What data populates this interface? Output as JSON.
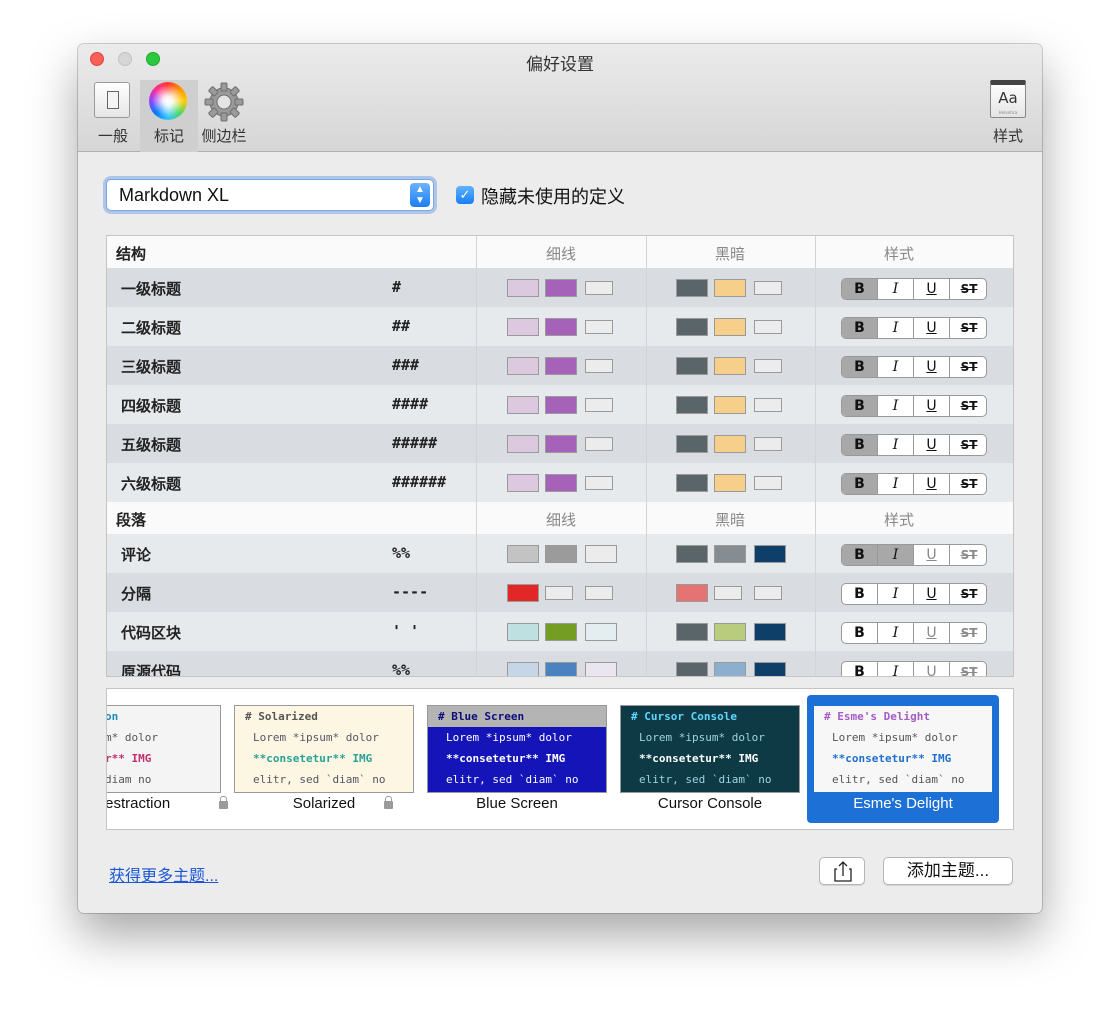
{
  "window": {
    "title": "偏好设置"
  },
  "toolbar": {
    "general_label": "一般",
    "markers_label": "标记",
    "sidebar_label": "侧边栏",
    "style_label": "样式",
    "style_icon_text": "Aa",
    "style_icon_sub": "Helvetica"
  },
  "syntax_select": {
    "value": "Markdown XL"
  },
  "hide_unused": {
    "label": "隐藏未使用的定义",
    "checked": true
  },
  "table": {
    "columns": {
      "thin": "细线",
      "dark": "黑暗",
      "style": "样式"
    },
    "sections": [
      {
        "title": "结构",
        "rows": [
          {
            "name": "一级标题",
            "syntax": "#"
          },
          {
            "name": "二级标题",
            "syntax": "##"
          },
          {
            "name": "三级标题",
            "syntax": "###"
          },
          {
            "name": "四级标题",
            "syntax": "####"
          },
          {
            "name": "五级标题",
            "syntax": "#####"
          },
          {
            "name": "六级标题",
            "syntax": "######"
          }
        ]
      },
      {
        "title": "段落",
        "rows": [
          {
            "name": "评论",
            "syntax": "%%"
          },
          {
            "name": "分隔",
            "syntax": "----"
          },
          {
            "name": "代码区块",
            "syntax": "' '"
          },
          {
            "name": "原源代码",
            "syntax": "%%"
          }
        ]
      }
    ],
    "style_buttons": {
      "bold": "B",
      "italic": "I",
      "underline": "U",
      "strike": "ST"
    }
  },
  "themes": [
    {
      "name": "reestraction",
      "locked": true,
      "lines": [
        "estraction",
        "em *ipsum* dolor",
        "onsetetur** IMG",
        "tr, sed diam no"
      ]
    },
    {
      "name": "Solarized",
      "locked": true,
      "lines": [
        "# Solarized",
        "Lorem *ipsum* dolor",
        "**consetetur** IMG",
        "elitr, sed `diam` no"
      ]
    },
    {
      "name": "Blue Screen",
      "locked": false,
      "lines": [
        "# Blue Screen",
        "Lorem *ipsum* dolor",
        "**consetetur** IMG",
        "elitr, sed `diam` no"
      ]
    },
    {
      "name": "Cursor Console",
      "locked": false,
      "lines": [
        "# Cursor Console",
        "Lorem *ipsum* dolor",
        "**consetetur** IMG",
        "elitr, sed `diam` no"
      ]
    },
    {
      "name": "Esme's Delight",
      "locked": false,
      "selected": true,
      "lines": [
        "# Esme's Delight",
        "Lorem *ipsum* dolor",
        "**consetetur** IMG",
        "elitr, sed `diam` no"
      ]
    }
  ],
  "footer": {
    "more_themes": "获得更多主题...",
    "add_theme": "添加主题..."
  },
  "colors": {
    "accent": "#1c70d6",
    "thin_heading_light": "#dcc8df",
    "thin_heading_purple": "#a662b8",
    "dark_slate": "#596569",
    "dark_gold": "#f6d08a",
    "navy": "#0e3f69"
  }
}
